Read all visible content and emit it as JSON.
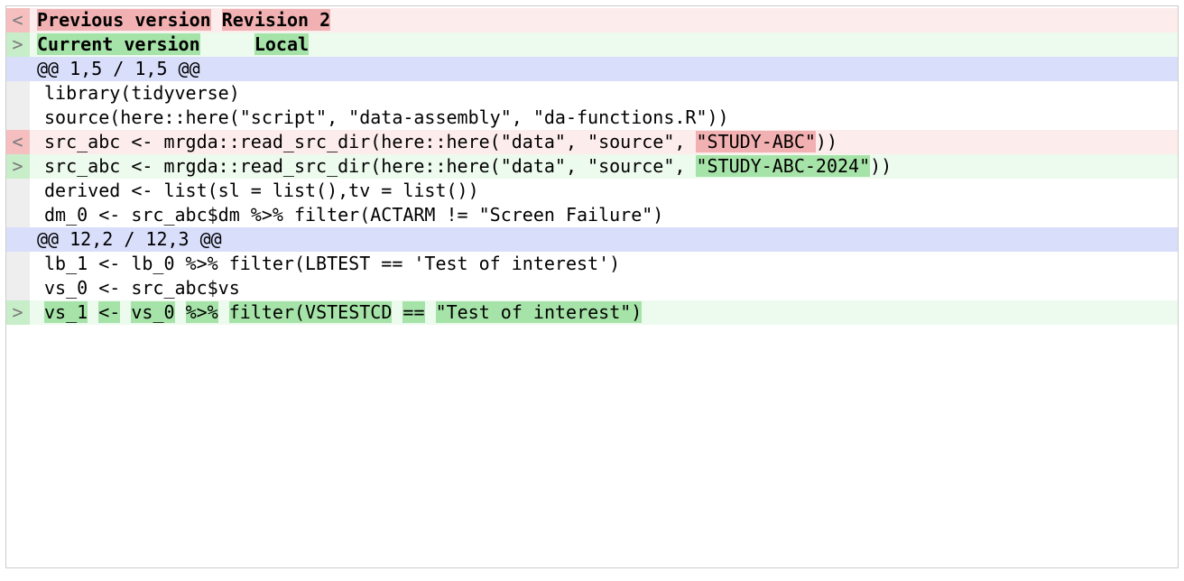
{
  "header": {
    "prev_marker": "<",
    "prev_label": "Previous version",
    "prev_rev": "Revision 2",
    "cur_marker": ">",
    "cur_label": "Current version",
    "cur_rev": "Local"
  },
  "hunks": {
    "h1": "@@ 1,5 / 1,5 @@",
    "h2": "@@ 12,2 / 12,3 @@"
  },
  "lines": {
    "l1": "library(tidyverse)",
    "l2": "source(here::here(\"script\", \"data-assembly\", \"da-functions.R\"))",
    "l3_pre": "src_abc <- mrgda::read_src_dir(here::here(\"data\", \"source\", ",
    "l3_del": "\"STUDY-ABC\"",
    "l3_post": "))",
    "l4_pre": "src_abc <- mrgda::read_src_dir(here::here(\"data\", \"source\", ",
    "l4_add": "\"STUDY-ABC-2024\"",
    "l4_post": "))",
    "l5": "derived <- list(sl = list(),tv = list())",
    "l6": "dm_0 <- src_abc$dm %>% filter(ACTARM != \"Screen Failure\")",
    "l7": "lb_1 <- lb_0 %>% filter(LBTEST == 'Test of interest')",
    "l8": "vs_0 <- src_abc$vs",
    "l9_a": "vs_1",
    "l9_s1": " ",
    "l9_b": "<-",
    "l9_s2": " ",
    "l9_c": "vs_0",
    "l9_s3": " ",
    "l9_d": "%>%",
    "l9_s4": " ",
    "l9_e": "filter(VSTESTCD",
    "l9_s5": " ",
    "l9_f": "==",
    "l9_s6": " ",
    "l9_g": "\"Test of interest\")"
  }
}
